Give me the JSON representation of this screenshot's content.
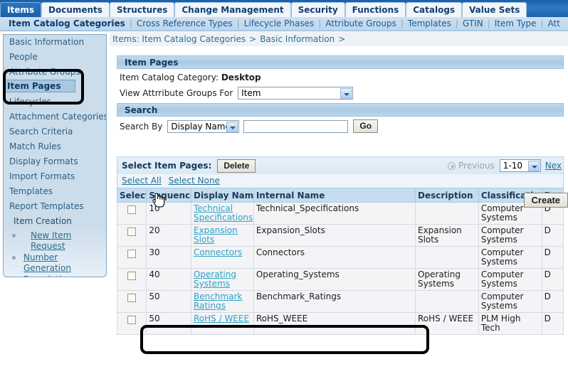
{
  "topnav": {
    "tabs": [
      {
        "label": "Items",
        "active": true
      },
      {
        "label": "Documents",
        "active": false
      },
      {
        "label": "Structures",
        "active": false
      },
      {
        "label": "Change Management",
        "active": false
      },
      {
        "label": "Security",
        "active": false
      },
      {
        "label": "Functions",
        "active": false
      },
      {
        "label": "Catalogs",
        "active": false
      },
      {
        "label": "Value Sets",
        "active": false
      }
    ]
  },
  "subnav": {
    "items": [
      {
        "label": "Item Catalog Categories",
        "current": true
      },
      {
        "label": "Cross Reference Types",
        "current": false
      },
      {
        "label": "Lifecycle Phases",
        "current": false
      },
      {
        "label": "Attribute Groups",
        "current": false
      },
      {
        "label": "Templates",
        "current": false
      },
      {
        "label": "GTIN",
        "current": false
      },
      {
        "label": "Item Type",
        "current": false
      },
      {
        "label": "Att",
        "current": false
      }
    ]
  },
  "sidebar": {
    "items": [
      {
        "label": "Basic Information",
        "selected": false
      },
      {
        "label": "People",
        "selected": false
      },
      {
        "label": "Attribute Groups",
        "selected": false
      },
      {
        "label": "Item Pages",
        "selected": true
      },
      {
        "label": "Lifecycles",
        "selected": false
      },
      {
        "label": "Attachment Categories",
        "selected": false
      },
      {
        "label": "Search Criteria",
        "selected": false
      },
      {
        "label": "Match Rules",
        "selected": false
      },
      {
        "label": "Display Formats",
        "selected": false
      },
      {
        "label": "Import Formats",
        "selected": false
      },
      {
        "label": "Templates",
        "selected": false
      },
      {
        "label": "Report Templates",
        "selected": false
      }
    ],
    "section_heading": "Item Creation",
    "links": [
      {
        "label": "New Item Request",
        "indent": true
      },
      {
        "label": "Number Generation",
        "indent": false
      },
      {
        "label": "Description Generation",
        "indent": false
      }
    ]
  },
  "breadcrumb": {
    "crumb1": "Items: Item Catalog Categories",
    "arrow1": ">",
    "crumb2": "Basic Information",
    "arrow2": ">"
  },
  "item_pages": {
    "panel_title": "Item Pages",
    "catalog_label": "Item Catalog Category:",
    "catalog_value": "Desktop",
    "view_for_label": "View Attrribute Groups For",
    "view_for_value": "Item"
  },
  "search": {
    "panel_title": "Search",
    "search_by_label": "Search By",
    "search_by_value": "Display Name",
    "query_value": "",
    "query_placeholder": "",
    "go_label": "Go"
  },
  "actions": {
    "create_label": "Create",
    "select_item_pages_label": "Select Item Pages:",
    "delete_label": "Delete",
    "select_all_label": "Select All",
    "select_none_label": "Select None",
    "previous_label": "Previous",
    "range_value": "1-10",
    "next_label": "Nex"
  },
  "table": {
    "columns": [
      "Select",
      "Sequence",
      "Display Name",
      "Internal Name",
      "Description",
      "Classification",
      "D"
    ],
    "rows": [
      {
        "sequence": "10",
        "display_name": "Technical Specifications",
        "internal_name": "Technical_Specifications",
        "description": "",
        "classification": "Computer Systems",
        "last": "D"
      },
      {
        "sequence": "20",
        "display_name": "Expansion Slots",
        "internal_name": "Expansion_Slots",
        "description": "Expansion Slots",
        "classification": "Computer Systems",
        "last": "D"
      },
      {
        "sequence": "30",
        "display_name": "Connectors",
        "internal_name": "Connectors",
        "description": "",
        "classification": "Computer Systems",
        "last": "D"
      },
      {
        "sequence": "40",
        "display_name": "Operating Systems",
        "internal_name": "Operating_Systems",
        "description": "Operating Systems",
        "classification": "Computer Systems",
        "last": "D"
      },
      {
        "sequence": "50",
        "display_name": "Benchmark Ratings",
        "internal_name": "Benchmark_Ratings",
        "description": "",
        "classification": "Computer Systems",
        "last": "D"
      },
      {
        "sequence": "50",
        "display_name": "RoHS / WEEE",
        "internal_name": "RoHS_WEEE",
        "description": "RoHS / WEEE",
        "classification": "PLM High Tech",
        "last": "D"
      }
    ]
  },
  "colors": {
    "tab_active": "#1a5fa8",
    "subnav_bg": "#c5daec",
    "sidebar_bg": "#cbdcea",
    "sidebar_selected": "#a8c8e0",
    "panel_header": "#a9cae4",
    "table_header": "#c6ddf0",
    "link": "#2aa2c8",
    "annotation": "#000000"
  }
}
